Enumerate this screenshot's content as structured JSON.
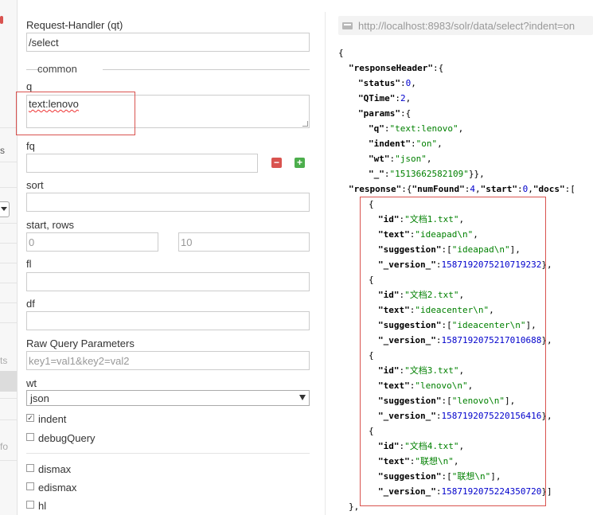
{
  "sidebar": {
    "fragments": [
      "s",
      "ts",
      "fo"
    ]
  },
  "form": {
    "request_handler_label": "Request-Handler (qt)",
    "request_handler_value": "/select",
    "common_label": "common",
    "q_label": "q",
    "q_value": "text:lenovo",
    "fq_label": "fq",
    "fq_value": "",
    "remove_label": "−",
    "add_label": "+",
    "sort_label": "sort",
    "sort_value": "",
    "start_rows_label": "start, rows",
    "start_placeholder": "0",
    "rows_placeholder": "10",
    "fl_label": "fl",
    "fl_value": "",
    "df_label": "df",
    "df_value": "",
    "raw_label": "Raw Query Parameters",
    "raw_placeholder": "key1=val1&key2=val2",
    "wt_label": "wt",
    "wt_value": "json",
    "indent_label": "indent",
    "indent_checked": true,
    "indent_mark": "✓",
    "debug_label": "debugQuery",
    "dismax_label": "dismax",
    "edismax_label": "edismax",
    "hl_label": "hl"
  },
  "results": {
    "url": "http://localhost:8983/solr/data/select?indent=on",
    "json_lines": [
      {
        "indent": 0,
        "parts": [
          [
            "p",
            "{"
          ]
        ]
      },
      {
        "indent": 1,
        "parts": [
          [
            "k",
            "\"responseHeader\""
          ],
          [
            "p",
            ":{"
          ]
        ]
      },
      {
        "indent": 2,
        "parts": [
          [
            "k",
            "\"status\""
          ],
          [
            "p",
            ":"
          ],
          [
            "n",
            "0"
          ],
          [
            "p",
            ","
          ]
        ]
      },
      {
        "indent": 2,
        "parts": [
          [
            "k",
            "\"QTime\""
          ],
          [
            "p",
            ":"
          ],
          [
            "n",
            "2"
          ],
          [
            "p",
            ","
          ]
        ]
      },
      {
        "indent": 2,
        "parts": [
          [
            "k",
            "\"params\""
          ],
          [
            "p",
            ":{"
          ]
        ]
      },
      {
        "indent": 3,
        "parts": [
          [
            "k",
            "\"q\""
          ],
          [
            "p",
            ":"
          ],
          [
            "s",
            "\"text:lenovo\""
          ],
          [
            "p",
            ","
          ]
        ]
      },
      {
        "indent": 3,
        "parts": [
          [
            "k",
            "\"indent\""
          ],
          [
            "p",
            ":"
          ],
          [
            "s",
            "\"on\""
          ],
          [
            "p",
            ","
          ]
        ]
      },
      {
        "indent": 3,
        "parts": [
          [
            "k",
            "\"wt\""
          ],
          [
            "p",
            ":"
          ],
          [
            "s",
            "\"json\""
          ],
          [
            "p",
            ","
          ]
        ]
      },
      {
        "indent": 3,
        "parts": [
          [
            "k",
            "\"_\""
          ],
          [
            "p",
            ":"
          ],
          [
            "s",
            "\"1513662582109\""
          ],
          [
            "p",
            "}},"
          ]
        ]
      },
      {
        "indent": 1,
        "parts": [
          [
            "k",
            "\"response\""
          ],
          [
            "p",
            ":{"
          ],
          [
            "k",
            "\"numFound\""
          ],
          [
            "p",
            ":"
          ],
          [
            "n",
            "4"
          ],
          [
            "p",
            ","
          ],
          [
            "k",
            "\"start\""
          ],
          [
            "p",
            ":"
          ],
          [
            "n",
            "0"
          ],
          [
            "p",
            ","
          ],
          [
            "k",
            "\"docs\""
          ],
          [
            "p",
            ":["
          ]
        ]
      },
      {
        "indent": 3,
        "parts": [
          [
            "p",
            "{"
          ]
        ]
      },
      {
        "indent": 4,
        "parts": [
          [
            "k",
            "\"id\""
          ],
          [
            "p",
            ":"
          ],
          [
            "s",
            "\"文档1.txt\""
          ],
          [
            "p",
            ","
          ]
        ]
      },
      {
        "indent": 4,
        "parts": [
          [
            "k",
            "\"text\""
          ],
          [
            "p",
            ":"
          ],
          [
            "s",
            "\"ideapad\\n\""
          ],
          [
            "p",
            ","
          ]
        ]
      },
      {
        "indent": 4,
        "parts": [
          [
            "k",
            "\"suggestion\""
          ],
          [
            "p",
            ":["
          ],
          [
            "s",
            "\"ideapad\\n\""
          ],
          [
            "p",
            "],"
          ]
        ]
      },
      {
        "indent": 4,
        "parts": [
          [
            "k",
            "\"_version_\""
          ],
          [
            "p",
            ":"
          ],
          [
            "n",
            "1587192075210719232"
          ],
          [
            "p",
            "},"
          ]
        ]
      },
      {
        "indent": 3,
        "parts": [
          [
            "p",
            "{"
          ]
        ]
      },
      {
        "indent": 4,
        "parts": [
          [
            "k",
            "\"id\""
          ],
          [
            "p",
            ":"
          ],
          [
            "s",
            "\"文档2.txt\""
          ],
          [
            "p",
            ","
          ]
        ]
      },
      {
        "indent": 4,
        "parts": [
          [
            "k",
            "\"text\""
          ],
          [
            "p",
            ":"
          ],
          [
            "s",
            "\"ideacenter\\n\""
          ],
          [
            "p",
            ","
          ]
        ]
      },
      {
        "indent": 4,
        "parts": [
          [
            "k",
            "\"suggestion\""
          ],
          [
            "p",
            ":["
          ],
          [
            "s",
            "\"ideacenter\\n\""
          ],
          [
            "p",
            "],"
          ]
        ]
      },
      {
        "indent": 4,
        "parts": [
          [
            "k",
            "\"_version_\""
          ],
          [
            "p",
            ":"
          ],
          [
            "n",
            "1587192075217010688"
          ],
          [
            "p",
            "},"
          ]
        ]
      },
      {
        "indent": 3,
        "parts": [
          [
            "p",
            "{"
          ]
        ]
      },
      {
        "indent": 4,
        "parts": [
          [
            "k",
            "\"id\""
          ],
          [
            "p",
            ":"
          ],
          [
            "s",
            "\"文档3.txt\""
          ],
          [
            "p",
            ","
          ]
        ]
      },
      {
        "indent": 4,
        "parts": [
          [
            "k",
            "\"text\""
          ],
          [
            "p",
            ":"
          ],
          [
            "s",
            "\"lenovo\\n\""
          ],
          [
            "p",
            ","
          ]
        ]
      },
      {
        "indent": 4,
        "parts": [
          [
            "k",
            "\"suggestion\""
          ],
          [
            "p",
            ":["
          ],
          [
            "s",
            "\"lenovo\\n\""
          ],
          [
            "p",
            "],"
          ]
        ]
      },
      {
        "indent": 4,
        "parts": [
          [
            "k",
            "\"_version_\""
          ],
          [
            "p",
            ":"
          ],
          [
            "n",
            "1587192075220156416"
          ],
          [
            "p",
            "},"
          ]
        ]
      },
      {
        "indent": 3,
        "parts": [
          [
            "p",
            "{"
          ]
        ]
      },
      {
        "indent": 4,
        "parts": [
          [
            "k",
            "\"id\""
          ],
          [
            "p",
            ":"
          ],
          [
            "s",
            "\"文档4.txt\""
          ],
          [
            "p",
            ","
          ]
        ]
      },
      {
        "indent": 4,
        "parts": [
          [
            "k",
            "\"text\""
          ],
          [
            "p",
            ":"
          ],
          [
            "s",
            "\"联想\\n\""
          ],
          [
            "p",
            ","
          ]
        ]
      },
      {
        "indent": 4,
        "parts": [
          [
            "k",
            "\"suggestion\""
          ],
          [
            "p",
            ":["
          ],
          [
            "s",
            "\"联想\\n\""
          ],
          [
            "p",
            "],"
          ]
        ]
      },
      {
        "indent": 4,
        "parts": [
          [
            "k",
            "\"_version_\""
          ],
          [
            "p",
            ":"
          ],
          [
            "n",
            "1587192075224350720"
          ],
          [
            "p",
            "}]"
          ]
        ]
      },
      {
        "indent": 1,
        "parts": [
          [
            "p",
            "},"
          ]
        ]
      }
    ]
  },
  "colors": {
    "highlight": "#d9534f",
    "json_key": "#000000",
    "json_string": "#008000",
    "json_number": "#0000cc"
  }
}
